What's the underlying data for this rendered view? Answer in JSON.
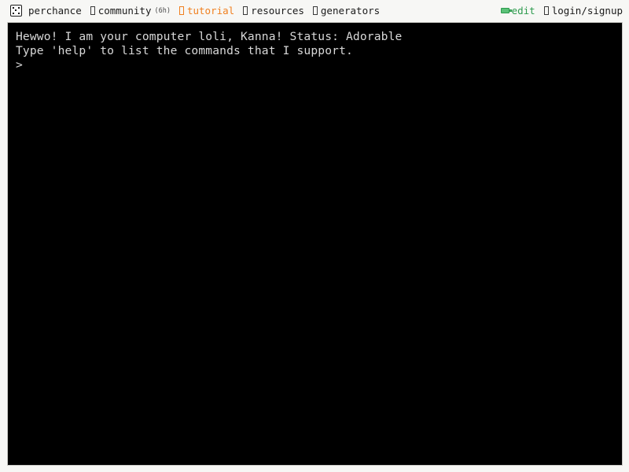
{
  "header": {
    "brand": {
      "label": "perchance",
      "icon": "dice-logo-icon"
    },
    "left_items": [
      {
        "label": "community",
        "sub": "(6h)",
        "icon": "tofu-box-icon",
        "accent": false
      },
      {
        "label": "tutorial",
        "sub": "",
        "icon": "tofu-box-icon",
        "accent": true
      },
      {
        "label": "resources",
        "sub": "",
        "icon": "tofu-box-icon",
        "accent": false
      },
      {
        "label": "generators",
        "sub": "",
        "icon": "tofu-box-icon",
        "accent": false
      }
    ],
    "right_items": [
      {
        "label": "edit",
        "icon": "edit-pencil-icon",
        "color": "#2e9b4e"
      },
      {
        "label": "login/signup",
        "icon": "tofu-box-icon",
        "color": "#1a1a1a"
      }
    ]
  },
  "terminal": {
    "lines": [
      "Hewwo! I am your computer loli, Kanna! Status: Adorable",
      "Type 'help' to list the commands that I support."
    ],
    "prompt_symbol": ">",
    "input_value": "",
    "input_placeholder": ""
  },
  "colors": {
    "page_background": "#f7f7f5",
    "terminal_background": "#000000",
    "terminal_text": "#d8d8d8",
    "accent_orange": "#f08020",
    "accent_green": "#2e9b4e",
    "nav_text": "#1a1a1a"
  }
}
